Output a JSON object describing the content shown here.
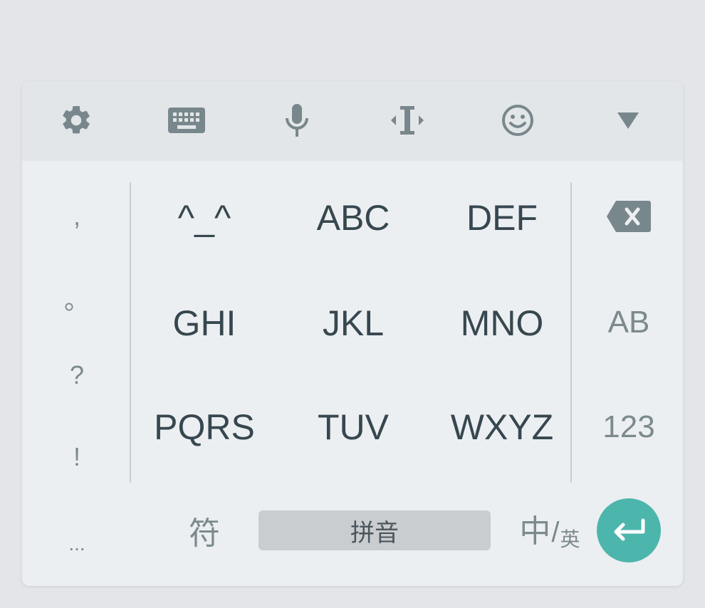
{
  "toolbar": {
    "items": [
      {
        "name": "settings",
        "icon": "gear-icon"
      },
      {
        "name": "keyboard",
        "icon": "keyboard-icon"
      },
      {
        "name": "voice",
        "icon": "microphone-icon"
      },
      {
        "name": "cursor",
        "icon": "text-cursor-icon"
      },
      {
        "name": "emoji",
        "icon": "smiley-icon"
      },
      {
        "name": "hide",
        "icon": "triangle-down-icon"
      }
    ]
  },
  "punctuation": [
    ",",
    "。",
    "?",
    "!",
    "..."
  ],
  "keys": {
    "row1": [
      "^_^",
      "ABC",
      "DEF"
    ],
    "row2": [
      "GHI",
      "JKL",
      "MNO"
    ],
    "row3": [
      "PQRS",
      "TUV",
      "WXYZ"
    ]
  },
  "side": {
    "backspace_icon": "backspace-icon",
    "ab": "AB",
    "num": "123"
  },
  "bottom": {
    "symbols": "符",
    "space": "拼音",
    "lang_main": "中",
    "lang_slash": "/",
    "lang_alt": "英",
    "enter_icon": "enter-icon"
  },
  "colors": {
    "background": "#eceff1",
    "toolbar": "#e3e6e9",
    "icon": "#78878c",
    "key_text": "#37474f",
    "secondary_text": "#7c8a8f",
    "accent": "#4db6ac"
  }
}
